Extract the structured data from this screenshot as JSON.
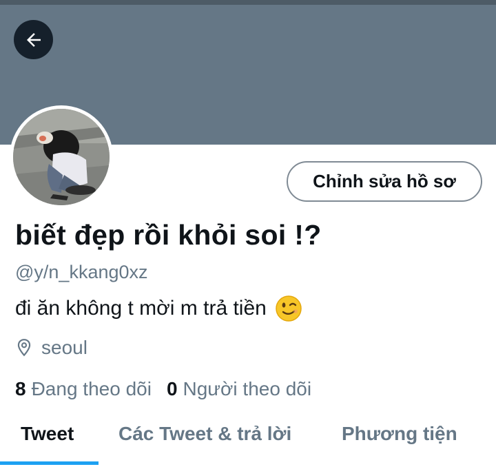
{
  "header": {
    "back_icon": "arrow-left-icon"
  },
  "profile": {
    "edit_label": "Chỉnh sửa hồ sơ",
    "display_name": "biết đẹp rồi khỏi soi !?",
    "handle": "@y/n_kkang0xz",
    "bio": "đi ăn không t mời m trả tiền",
    "bio_emoji": "winking-face-emoji",
    "location_icon": "location-pin-icon",
    "location": "seoul"
  },
  "stats": {
    "following_count": "8",
    "following_label": "Đang theo dõi",
    "followers_count": "0",
    "followers_label": "Người theo dõi"
  },
  "tabs": [
    {
      "label": "Tweet",
      "active": true
    },
    {
      "label": "Các Tweet & trả lời",
      "active": false
    },
    {
      "label": "Phương tiện",
      "active": false
    }
  ],
  "colors": {
    "banner": "#657786",
    "accent": "#1da1f2",
    "secondary_text": "#657786"
  }
}
